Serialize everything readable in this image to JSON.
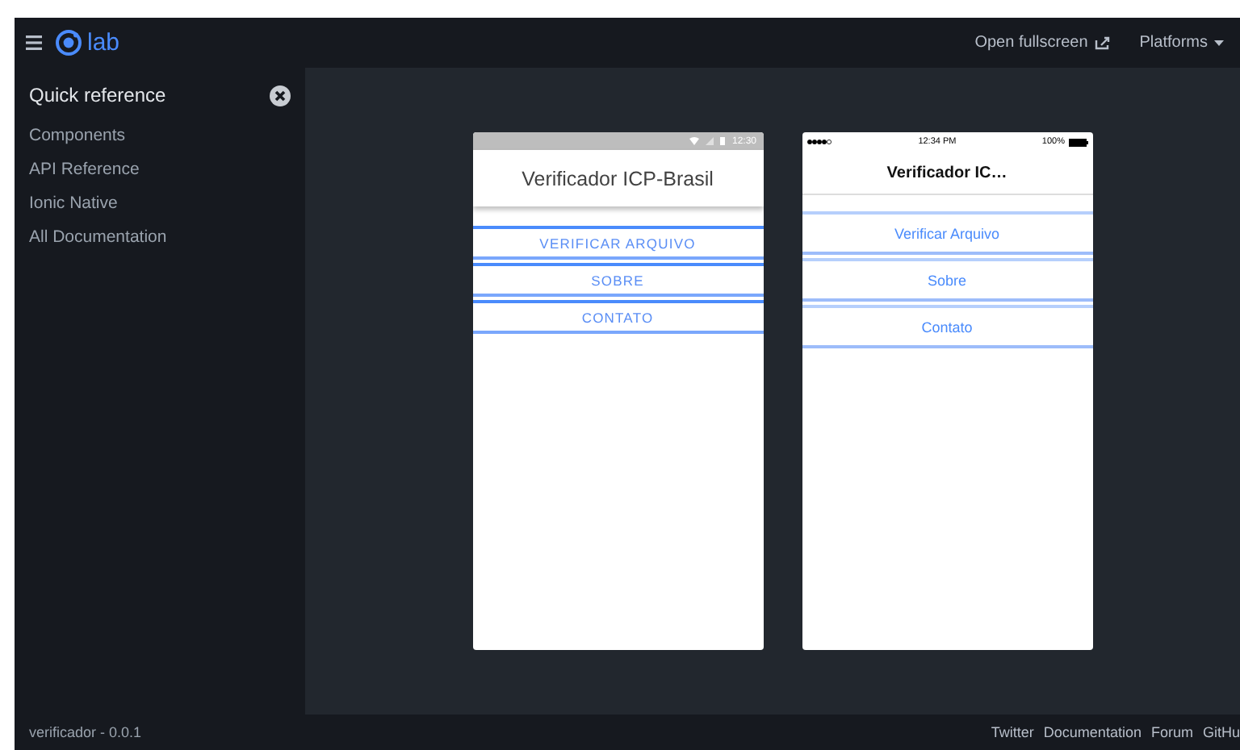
{
  "header": {
    "logo": "lab",
    "actions": [
      {
        "label": "Open fullscreen",
        "kind": "external"
      },
      {
        "label": "Platforms",
        "kind": "dropdown"
      }
    ]
  },
  "sidebar": {
    "title": "Quick reference",
    "items": [
      "Components",
      "API Reference",
      "Ionic Native",
      "All Documentation"
    ]
  },
  "previews": [
    {
      "kind": "android",
      "time": "12:30",
      "title": "Verificador ICP-Brasil",
      "items": [
        "VERIFICAR ARQUIVO",
        "SOBRE",
        "CONTATO"
      ]
    },
    {
      "kind": "ios",
      "time": "12:34 PM",
      "battery": "100%",
      "title": "Verificador IC…",
      "items": [
        "Verificar Arquivo",
        "Sobre",
        "Contato"
      ]
    }
  ],
  "footer": {
    "version": "verificador - 0.0.1",
    "links": [
      "Twitter",
      "Documentation",
      "Forum",
      "GitHu"
    ]
  }
}
